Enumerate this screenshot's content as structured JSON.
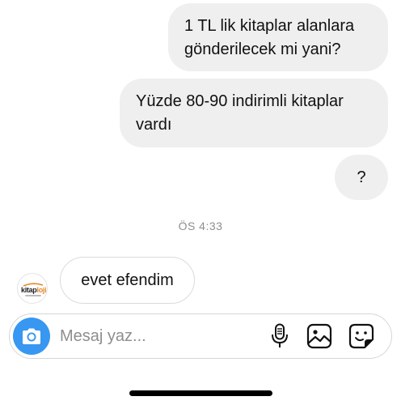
{
  "thread": {
    "outgoing": [
      {
        "text": "1 TL lik kitaplar alanlara\ngönderilecek mi yani?"
      },
      {
        "text": "Yüzde 80-90 indirimli kitaplar\nvardı"
      },
      {
        "text": "?"
      }
    ],
    "timestamp": "ÖS 4:33",
    "incoming": [
      {
        "text": "evet efendim"
      }
    ],
    "avatar": {
      "logo_main": "kitap",
      "logo_accent": "loji",
      "accent_color": "#e0892a"
    }
  },
  "composer": {
    "placeholder": "Mesaj yaz...",
    "camera_icon": "camera-icon",
    "mic_icon": "microphone-icon",
    "gallery_icon": "gallery-icon",
    "sticker_icon": "sticker-icon",
    "camera_color": "#3897f0"
  }
}
